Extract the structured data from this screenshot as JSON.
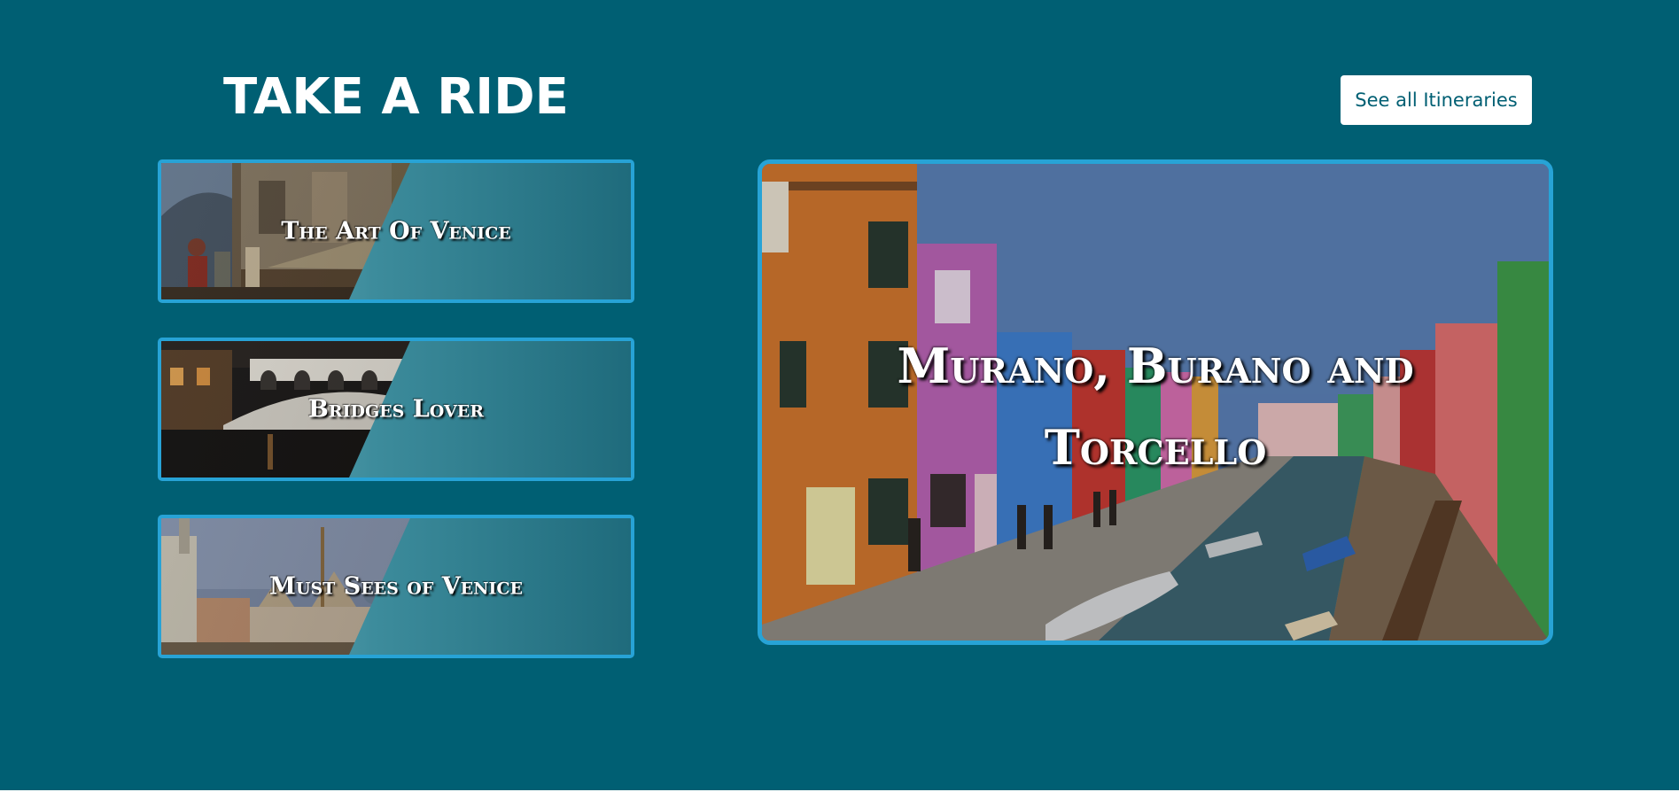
{
  "section": {
    "title": "TAKE A RIDE",
    "cta_label": "See all Itineraries"
  },
  "cards": [
    {
      "label": "The Art Of Venice",
      "image": "renaissance-painting-thumbnail"
    },
    {
      "label": "Bridges Lover",
      "image": "rialto-bridge-night-thumbnail"
    },
    {
      "label": "Must Sees of Venice",
      "image": "st-marks-basilica-thumbnail"
    }
  ],
  "feature": {
    "label": "Murano, Burano and Torcello",
    "image": "burano-colorful-canal-photo"
  },
  "colors": {
    "background": "#005f73",
    "accent_border": "#27a3d6",
    "button_bg": "#ffffff",
    "button_text": "#005f73",
    "label_text": "#ffffff"
  }
}
